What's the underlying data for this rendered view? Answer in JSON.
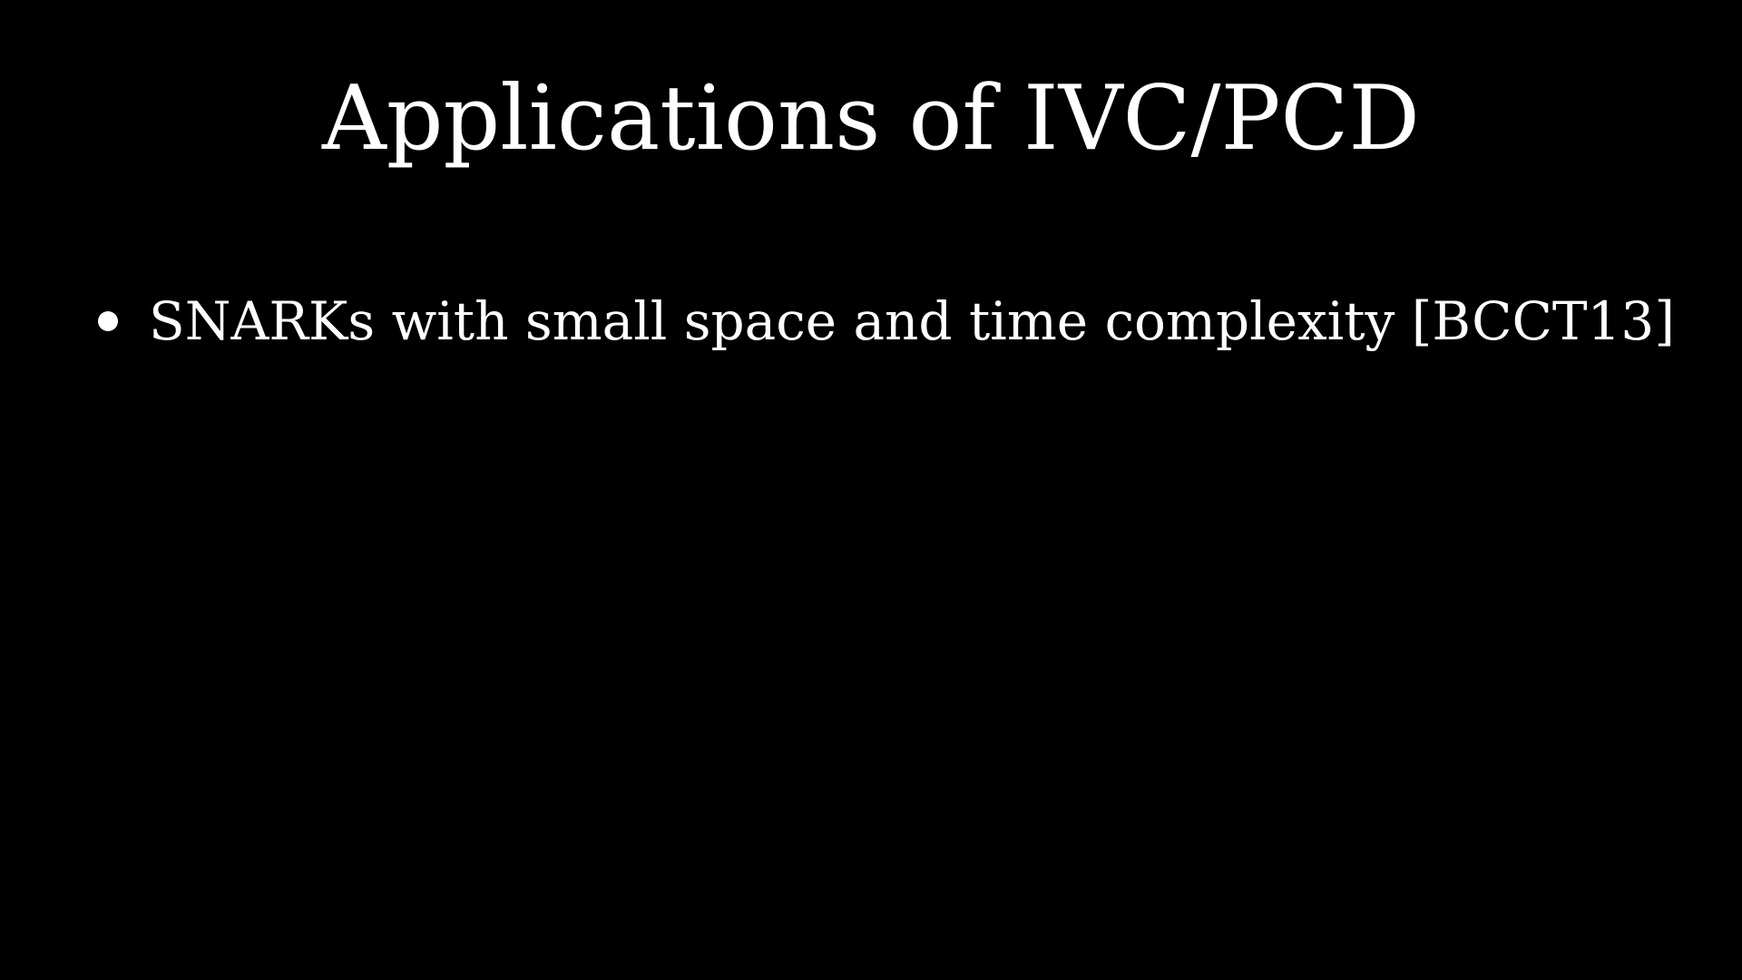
{
  "slide": {
    "title": "Applications of IVC/PCD",
    "bullets": [
      "SNARKs with small space and time complexity [BCCT13]"
    ]
  },
  "colors": {
    "background": "#000000",
    "text": "#ffffff"
  }
}
